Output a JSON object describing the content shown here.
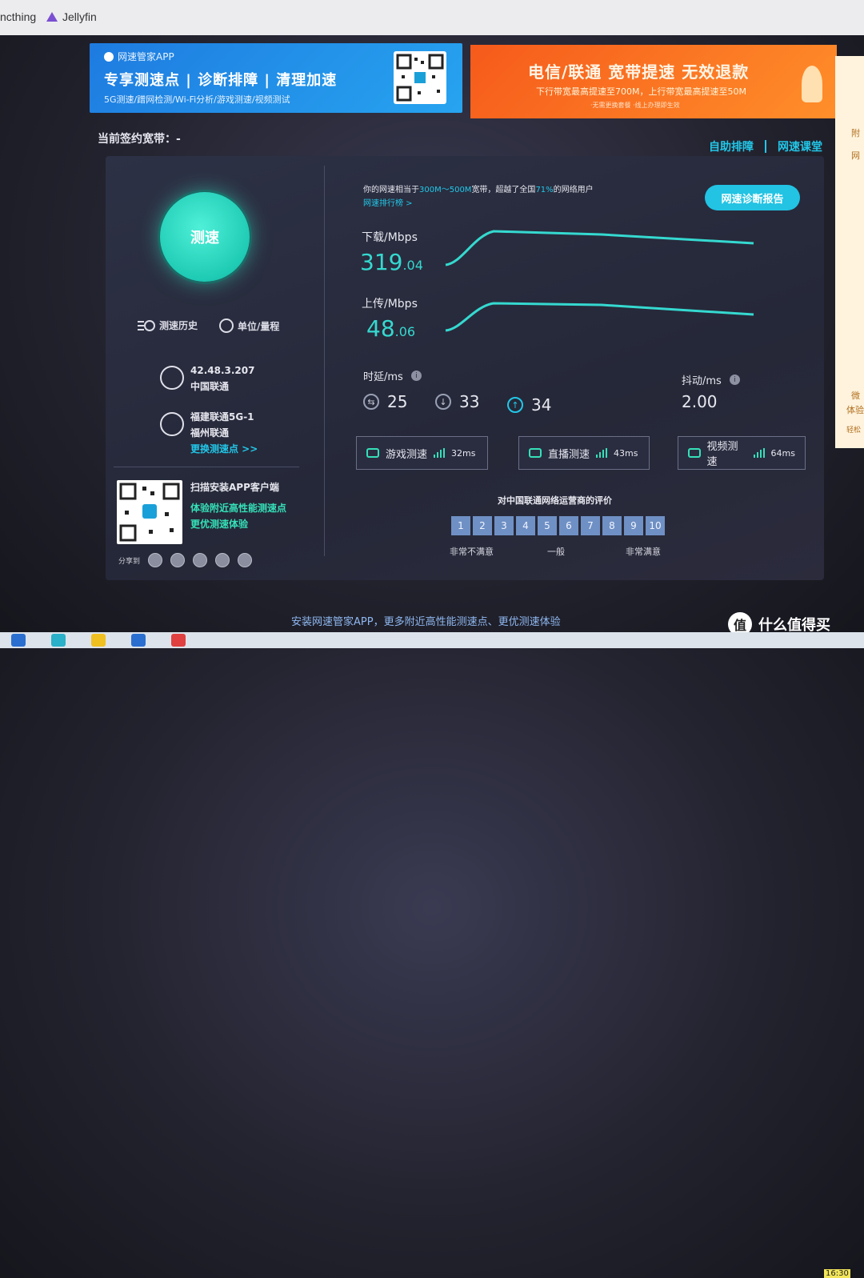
{
  "bookmarks": [
    "ncthing",
    "Jellyfin"
  ],
  "banner1": {
    "brand": "网速管家APP",
    "headline": "专享测速点 | 诊断排障 | 清理加速",
    "subline": "5G测速/蹭网检测/Wi-Fi分析/游戏测速/视频测试"
  },
  "banner2": {
    "headline": "电信/联通 宽带提速 无效退款",
    "subline": "下行带宽最高提速至700M，上行带宽最高提速至50M",
    "note": "·无需更换套餐   ·线上办理即生效"
  },
  "side_card": [
    "附",
    "网",
    "微",
    "体验",
    "轻松"
  ],
  "contract": "当前签约宽带：-",
  "links": {
    "self_fix": "自助排障",
    "course": "网速课堂"
  },
  "left": {
    "speed_button": "测速",
    "history": "测速历史",
    "units": "单位/量程",
    "ip": "42.48.3.207",
    "isp": "中国联通",
    "server": "福建联通5G-1",
    "server_isp": "福州联通",
    "change_server": "更换测速点 >>",
    "qr_title": "扫描安装APP客户端",
    "qr_line1": "体验附近高性能测速点",
    "qr_line2": "更优测速体验",
    "share_label": "分享到"
  },
  "result": {
    "rank_prefix": "你的网速相当于",
    "rank_band": "300M～500M",
    "rank_mid": "宽带，超越了全国",
    "rank_pct": "71%",
    "rank_suffix": "的网络用户",
    "rank_link": "网速排行榜 >",
    "diag_button": "网速诊断报告",
    "download_label": "下载/Mbps",
    "download_int": "319",
    "download_dec": ".04",
    "upload_label": "上传/Mbps",
    "upload_int": "48",
    "upload_dec": ".06",
    "latency_label": "时延/ms",
    "latency_1": "25",
    "latency_2": "33",
    "latency_3": "34",
    "jitter_label": "抖动/ms",
    "jitter": "2.00"
  },
  "tests": [
    {
      "label": "游戏测速",
      "ms": "32ms"
    },
    {
      "label": "直播测速",
      "ms": "43ms"
    },
    {
      "label": "视频测速",
      "ms": "64ms"
    }
  ],
  "rating": {
    "title": "对中国联通网络运营商的评价",
    "values": [
      "1",
      "2",
      "3",
      "4",
      "5",
      "6",
      "7",
      "8",
      "9",
      "10"
    ],
    "low": "非常不满意",
    "mid": "一般",
    "high": "非常满意"
  },
  "bottom_ad": "安装网速管家APP，更多附近高性能测速点、更优测速体验",
  "watermark": {
    "logo": "值",
    "text": "什么值得买"
  },
  "clock": "16:30",
  "colors": {
    "accent": "#22c7e8",
    "teal": "#35d9d0",
    "banner_orange": "#f65a1b",
    "banner_blue": "#1e7be0"
  }
}
